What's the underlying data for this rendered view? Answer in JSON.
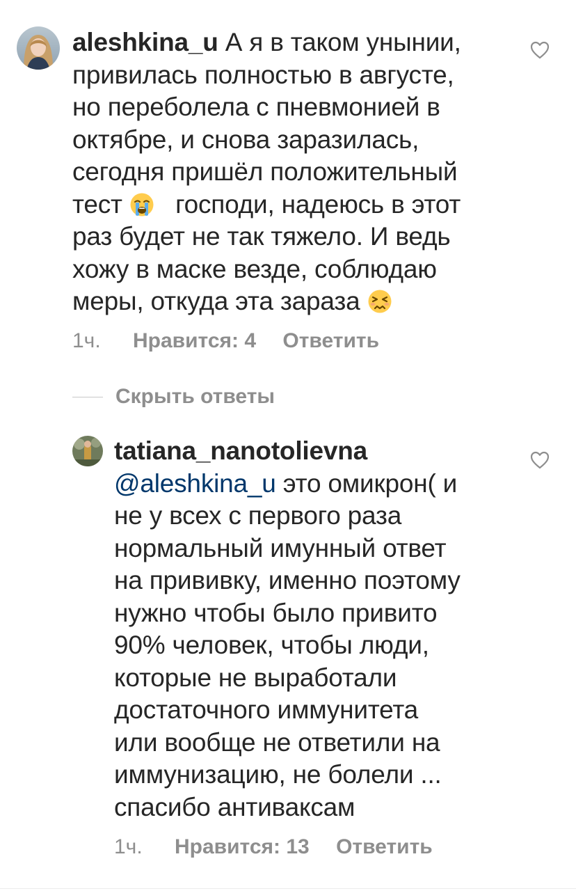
{
  "comment": {
    "username": "aleshkina_u",
    "lines": [
      "А я в таком унынии,",
      "привилась полностью в августе,",
      "но переболела с пневмонией в",
      "октябре, и снова заразилась,",
      "сегодня пришёл положительный",
      "тест",
      "господи, надеюсь в этот",
      "раз будет не так тяжело. И ведь",
      "хожу в маске везде, соблюдаю",
      "меры, откуда эта зараза"
    ],
    "emoji_1": "loudly-crying-face-emoji",
    "emoji_2": "persevering-face-emoji",
    "time": "1ч.",
    "likes": "Нравится: 4",
    "reply": "Ответить",
    "like_icon": "heart-icon"
  },
  "toggle_replies": {
    "label": "Скрыть ответы"
  },
  "reply_comment": {
    "username": "tatiana_nanotolievna",
    "mention": "@aleshkina_u",
    "lines": [
      "это омикрон( и",
      "не у всех с первого раза",
      "нормальный имунный ответ",
      "на прививку, именно поэтому",
      "нужно чтобы было привито",
      "90% человек, чтобы люди,",
      "которые не выработали",
      "достаточного иммунитета",
      "или вообще не ответили на",
      "иммунизацию, не болели ...",
      "спасибо антиваксам"
    ],
    "time": "1ч.",
    "likes": "Нравится: 13",
    "reply": "Ответить",
    "like_icon": "heart-icon"
  },
  "colors": {
    "text": "#262626",
    "secondary": "#8e8e8e",
    "mention": "#00376b",
    "divider": "#c7c7c7"
  }
}
